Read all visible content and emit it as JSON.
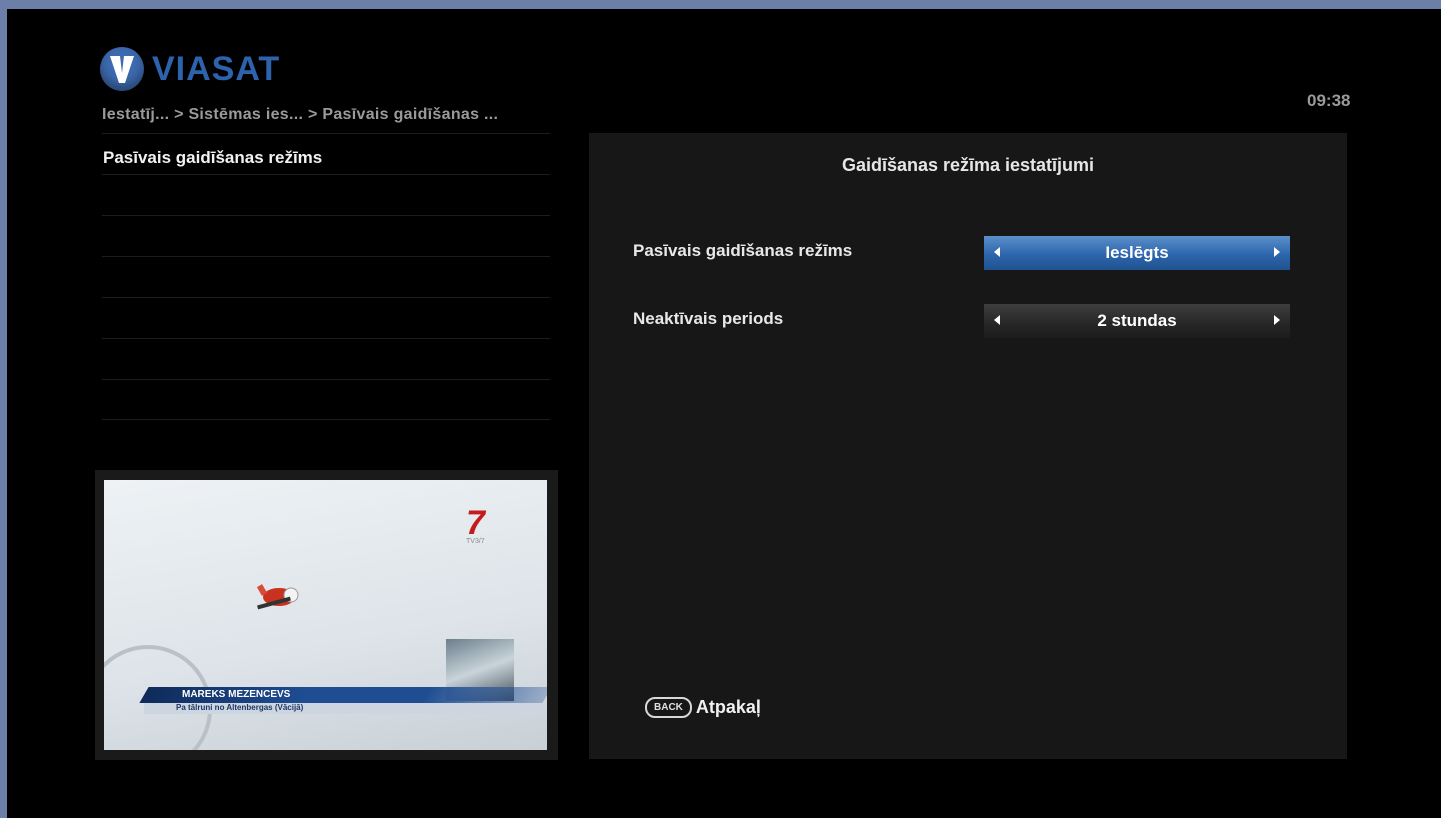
{
  "brand": {
    "name": "VIASAT"
  },
  "header": {
    "breadcrumb": "Iestatīj... > Sistēmas ies... > Pasīvais gaidīšanas ...",
    "clock": "09:38"
  },
  "menu": {
    "items": [
      {
        "label": "Pasīvais gaidīšanas režīms"
      },
      {
        "label": ""
      },
      {
        "label": ""
      },
      {
        "label": ""
      },
      {
        "label": ""
      },
      {
        "label": ""
      },
      {
        "label": ""
      }
    ]
  },
  "preview": {
    "channel_logo": "7",
    "channel_logo_sub": "TV3/7",
    "caption_name": "MAREKS MEZENCEVS",
    "caption_sub": "Pa tālruni no Altenbergas (Vācijā)"
  },
  "panel": {
    "title": "Gaidīšanas režīma iestatījumi",
    "settings": [
      {
        "label": "Pasīvais gaidīšanas režīms",
        "value": "Ieslēgts",
        "active": true
      },
      {
        "label": "Neaktīvais periods",
        "value": "2 stundas",
        "active": false
      }
    ],
    "back_key": "BACK",
    "back_label": "Atpakaļ"
  },
  "colors": {
    "outer_frame": "#6b7fa8",
    "brand_blue": "#2d63ad",
    "highlight": "#2d66ad",
    "broadcaster_red": "#c41b1b"
  },
  "icons": {
    "logo": "viasat-v-logo-icon",
    "left_arrow": "arrow-left-icon",
    "right_arrow": "arrow-right-icon"
  }
}
